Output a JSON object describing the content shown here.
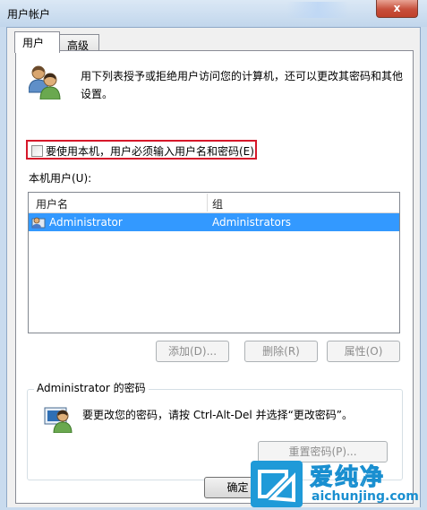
{
  "window": {
    "title": "用户帐户",
    "close_label": "x"
  },
  "tabs": [
    {
      "label": "用户",
      "active": true
    },
    {
      "label": "高级",
      "active": false
    }
  ],
  "description": {
    "line1": "用下列表授予或拒绝用户访问您的计算机，还可以更改其密码和其他",
    "line2": "设置。"
  },
  "require_password": {
    "label": "要使用本机，用户必须输入用户名和密码(E)",
    "checked": false
  },
  "local_users": {
    "label": "本机用户(U):",
    "columns": [
      "用户名",
      "组"
    ],
    "rows": [
      {
        "username": "Administrator",
        "group": "Administrators",
        "selected": true
      }
    ]
  },
  "buttons": {
    "add": "添加(D)...",
    "remove": "删除(R)",
    "properties": "属性(O)",
    "reset_password": "重置密码(P)...",
    "ok": "确定"
  },
  "password_group": {
    "title": "Administrator 的密码",
    "text": "要更改您的密码，请按 Ctrl-Alt-Del 并选择“更改密码”。"
  },
  "watermark": {
    "title": "爱纯净",
    "url": "aichunjing.com"
  },
  "colors": {
    "selection": "#3399ff",
    "highlight_border": "#d6182a",
    "watermark": "#1a8fd0"
  }
}
